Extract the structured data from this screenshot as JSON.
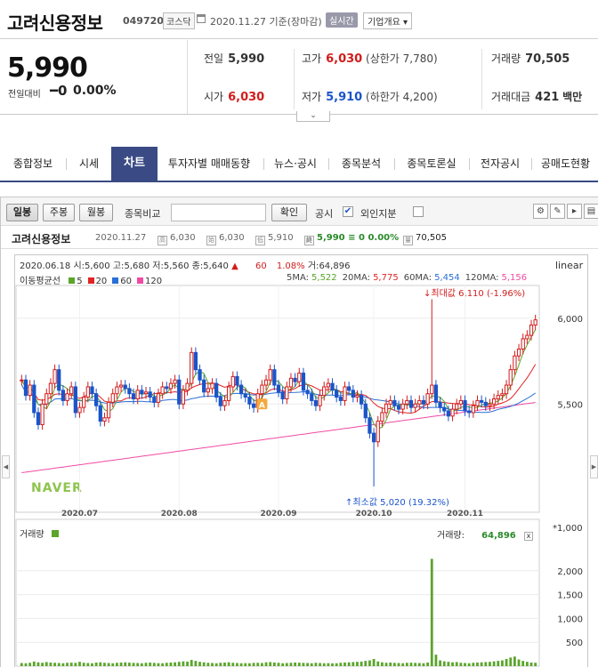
{
  "header": {
    "name": "고려신용정보",
    "code": "049720",
    "market": "코스닥",
    "date": "2020.11.27 기준(장마감)",
    "realtime": "실시간",
    "overview": "기업개요 ▾"
  },
  "summary": {
    "price": "5,990",
    "change_label": "전일대비",
    "change_value": "━0",
    "change_pct": "0.00%",
    "prev_label": "전일",
    "prev": "5,990",
    "high_label": "고가",
    "high": "6,030",
    "upper_limit": "(상한가 7,780)",
    "volume_label": "거래량",
    "volume": "70,505",
    "open_label": "시가",
    "open": "6,030",
    "low_label": "저가",
    "low": "5,910",
    "lower_limit": "(하한가 4,200)",
    "amount_label": "거래대금",
    "amount": "421",
    "amount_unit": "백만"
  },
  "tabs": [
    "종합정보",
    "시세",
    "차트",
    "투자자별 매매동향",
    "뉴스·공시",
    "종목분석",
    "종목토론실",
    "전자공시",
    "공매도현황"
  ],
  "toolbar": {
    "daily": "일봉",
    "weekly": "주봉",
    "monthly": "월봉",
    "compare_label": "종목비교",
    "confirm": "확인",
    "disclosure": "공시",
    "check_mark": "✔",
    "foreign": "외인지분"
  },
  "info": {
    "name": "고려신용정보",
    "date": "2020.11.27",
    "high": "6,030",
    "open": "6,030",
    "low": "5,910",
    "close": "5,990",
    "change": "≡ 0",
    "pct": "0.00%",
    "volume": "70,505"
  },
  "chart_header": {
    "date": "2020.06.18",
    "open_l": "시:",
    "open": "5,600",
    "high_l": "고:",
    "high": "5,680",
    "low_l": "저:",
    "low": "5,560",
    "close_l": "종:",
    "close": "5,640",
    "arrow": "▲",
    "chg": "60",
    "pct": "1.08%",
    "vol_l": "거:",
    "vol": "64,896"
  },
  "legend": {
    "title": "이동평균선",
    "ma": [
      {
        "label": "5",
        "color": "#5aa52a"
      },
      {
        "label": "20",
        "color": "#e02424"
      },
      {
        "label": "60",
        "color": "#2a6fd6"
      },
      {
        "label": "120",
        "color": "#f04aa4"
      }
    ],
    "values": [
      {
        "label": "5MA:",
        "value": "5,522",
        "color": "#5aa52a"
      },
      {
        "label": "20MA:",
        "value": "5,775",
        "color": "#e02424"
      },
      {
        "label": "60MA:",
        "value": "5,454",
        "color": "#2a6fd6"
      },
      {
        "label": "120MA:",
        "value": "5,156",
        "color": "#f04aa4"
      }
    ],
    "scale": "linear"
  },
  "annotations": {
    "max": "↓최대값 6,110 (-1.96%)",
    "min": "↑최소값 5,020 (19.32%)",
    "watermark": "NAVER",
    "a_marker": "A"
  },
  "volume_panel": {
    "label": "거래량",
    "current_label": "거래량:",
    "current": "64,896",
    "unit": "*1,000",
    "close_x": "x"
  },
  "colors": {
    "up": "#d21c1c",
    "down": "#1a54c9",
    "tab": "#3a4a84"
  },
  "chart_data": {
    "type": "candlestick",
    "x_ticks": [
      "2020.07",
      "2020.08",
      "2020.09",
      "2020.10",
      "2020.11"
    ],
    "y_ticks": [
      5500,
      6000
    ],
    "y_range": [
      4880,
      6180
    ],
    "volume_ticks": [
      500,
      1000,
      1500,
      2000
    ],
    "volume_range": [
      0,
      2500
    ],
    "close": [
      5640,
      5550,
      5610,
      5450,
      5380,
      5500,
      5560,
      5620,
      5700,
      5580,
      5520,
      5560,
      5600,
      5450,
      5480,
      5540,
      5600,
      5560,
      5490,
      5400,
      5420,
      5510,
      5560,
      5600,
      5610,
      5590,
      5560,
      5530,
      5580,
      5560,
      5570,
      5540,
      5510,
      5560,
      5600,
      5590,
      5620,
      5640,
      5500,
      5580,
      5620,
      5800,
      5700,
      5640,
      5570,
      5590,
      5620,
      5540,
      5490,
      5520,
      5600,
      5660,
      5610,
      5560,
      5540,
      5500,
      5480,
      5560,
      5610,
      5640,
      5700,
      5610,
      5570,
      5530,
      5600,
      5650,
      5630,
      5680,
      5580,
      5560,
      5520,
      5490,
      5550,
      5600,
      5620,
      5580,
      5540,
      5520,
      5600,
      5580,
      5540,
      5550,
      5500,
      5420,
      5330,
      5280,
      5400,
      5450,
      5500,
      5520,
      5490,
      5470,
      5500,
      5520,
      5480,
      5500,
      5520,
      5500,
      5560,
      5610,
      5510,
      5480,
      5460,
      5430,
      5470,
      5500,
      5520,
      5460,
      5450,
      5490,
      5520,
      5510,
      5490,
      5500,
      5530,
      5550,
      5560,
      5610,
      5700,
      5780,
      5820,
      5880,
      5900,
      5960,
      5990
    ],
    "volume": [
      64.9,
      60,
      70,
      95,
      80,
      70,
      85,
      75,
      70,
      65,
      60,
      70,
      72,
      68,
      90,
      70,
      65,
      60,
      75,
      80,
      70,
      65,
      60,
      70,
      75,
      80,
      72,
      68,
      65,
      60,
      70,
      75,
      68,
      62,
      60,
      70,
      75,
      80,
      90,
      100,
      95,
      130,
      110,
      90,
      80,
      70,
      65,
      60,
      70,
      75,
      80,
      70,
      65,
      60,
      62,
      60,
      68,
      70,
      65,
      80,
      85,
      75,
      70,
      60,
      65,
      70,
      75,
      72,
      68,
      65,
      60,
      70,
      65,
      60,
      62,
      58,
      60,
      70,
      75,
      80,
      85,
      90,
      95,
      110,
      120,
      150,
      100,
      80,
      70,
      75,
      68,
      65,
      60,
      70,
      72,
      68,
      65,
      60,
      75,
      2250,
      240,
      120,
      100,
      90,
      80,
      85,
      70,
      65,
      60,
      70,
      75,
      80,
      85,
      90,
      100,
      110,
      120,
      150,
      180,
      200,
      140,
      110,
      90,
      75,
      70.5
    ]
  }
}
